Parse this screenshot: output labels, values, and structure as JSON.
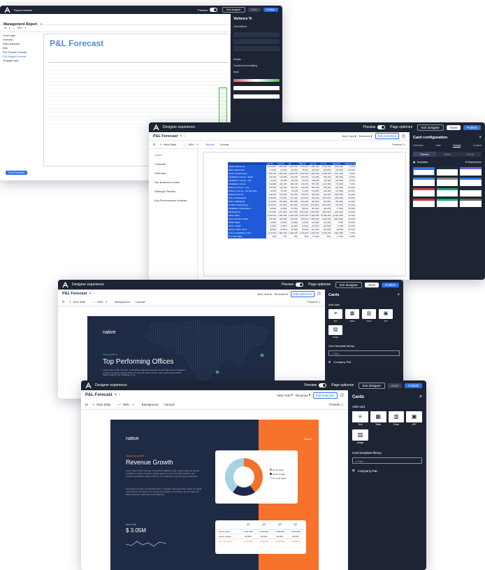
{
  "win1": {
    "app_title": "Report Header",
    "title": "Management Report",
    "page_title": "P&L Forecast",
    "nav_items": [
      "Cover page",
      "Overview",
      "Sales summary",
      "Risk",
      "P&L Product Forecast",
      "P&L Budget Forecast",
      "Template slide"
    ],
    "right_panel_title": "Variance %",
    "right_panel_sections": [
      "Calculations",
      "Details",
      "Conditional formatting",
      "Style"
    ],
    "preview_label": "Preview",
    "exit_designer": "Exit designer",
    "save": "Save",
    "publish": "Publish",
    "footer_button": "Send feedback"
  },
  "win2": {
    "app_title": "Designer experience",
    "preview_label": "Preview",
    "page_options": "Page options",
    "exit_designer": "Exit designer",
    "save": "Save",
    "publish": "Publish",
    "report_title": "P&L Forecast",
    "new_slide": "New Slide",
    "zoom": "96%",
    "tabs": [
      "Stories",
      "Format"
    ],
    "present": "Present",
    "filter_ny": "New York",
    "filter_rev": "Revenue",
    "edit_selection": "Edit selection",
    "slides": [
      "Cover",
      "Contents",
      "Overview",
      "Our Business model",
      "Strategic Review",
      "Key Performance Indicato..."
    ],
    "card_config_title": "Card configuration",
    "card_config_tabs": [
      "Overview",
      "Data",
      "Format",
      "Context"
    ],
    "card_config_subtabs": [
      "Themes",
      "Styles",
      "Format"
    ],
    "templates_label": "Templates",
    "reset_theme": "Reset theme",
    "table_headers": [
      "Jan 21",
      "Feb 21",
      "Q1",
      "Mar 21",
      "Apr 21",
      "FY 21",
      "Variance",
      "Variance %"
    ],
    "table_rows": [
      [
        "Product Revenue",
        "1,000,000",
        "1,000,000",
        "1,000,000",
        "1,000,000",
        "1,000,000",
        "6,000,000",
        "(400,000)",
        "-7.00%"
      ],
      [
        "Sales adjustment",
        "(7,000)",
        "(8,000)",
        "(8,000)",
        "(8,000)",
        "(18,000)",
        "(68,000)",
        "(42,000)",
        "-22.00%"
      ],
      [
        "Gross product sales",
        "530,000",
        "1,000,000",
        "1,000,000",
        "1,000,000",
        "1,000,000",
        "6,000,000",
        "(447,000)",
        "-9.00%"
      ],
      [
        "Installation Income - Sales",
        "140,000",
        "140,000",
        "140,000",
        "140,000",
        "140,000",
        "840,000",
        "(60,000)",
        "-8.00%"
      ],
      [
        "Installation Income - rate",
        "40,000",
        "30,000",
        "40,000",
        "40,000",
        "160,000",
        "240,000",
        "(20,000)",
        "-8.00%"
      ],
      [
        "Installation income",
        "210,000",
        "220,000",
        "400,000",
        "210,000",
        "830,000",
        "1,100,000",
        "(70,000)",
        "-7.00%"
      ],
      [
        "Delivery Income - cost",
        "130,000",
        "110,000",
        "140,000",
        "120,000",
        "500,000",
        "600,000",
        "(28,000)",
        "-23.00%"
      ],
      [
        "Delivery income - net 3rd party",
        "30,000",
        "40,000",
        "32,000",
        "(1,000)",
        "130,000",
        "200,000",
        "(47,000)",
        "-23.00%"
      ],
      [
        "Delivery income",
        "160,000",
        "150,000",
        "110,000",
        "130,000",
        "600,000",
        "800,000",
        "(118,000)",
        "20.00%"
      ],
      [
        "Store maintenance",
        "(60,000)",
        "(70,000)",
        "(70,000)",
        "(20,000)",
        "(60,000)",
        "(190,000)",
        "(100,000)",
        "30.00%"
      ],
      [
        "Store & Buildings",
        "(20,000)",
        "(30,000)",
        "(40,000)",
        "(30,000)",
        "(60,000)",
        "(60,000)",
        "(30,000)",
        "14.00%"
      ],
      [
        "Product maintenance",
        "(60,000)",
        "(40,000)",
        "(40,000)",
        "(90,000)",
        "(170,000)",
        "(209,000)",
        "(40,000)",
        "15.00%"
      ],
      [
        "Installation maintenance",
        "(8,000)",
        "(8,000)",
        "(9,000)",
        "(8,000)",
        "(32,000)",
        "(38,000)",
        "(7,000)",
        "15.00%"
      ],
      [
        "Maintenance",
        "(90,000)",
        "(110,000)",
        "(110,000)",
        "(100,000)",
        "(460,000)",
        "(590,000)",
        "(160,000)",
        "33.00%"
      ],
      [
        "Other Sales",
        "2,090,000",
        "2,000,000",
        "2,000,000",
        "2,000,000",
        "8,000,000",
        "10,000,000",
        "(2,000,000)",
        "30.00%"
      ],
      [
        "Cost of product sales",
        "400,000",
        "400,000",
        "400,000",
        "400,000",
        "1,600,000",
        "2,000,000",
        "(800,000)",
        "30.00%"
      ],
      [
        "PPAD Sales",
        "(4,000)",
        "(5,000)",
        "(4,000)",
        "(4,000)",
        "(16,000)",
        "(20,000)",
        "4,000",
        "20.00%"
      ],
      [
        "Gross margin",
        "(4,000)",
        "(4,000)",
        "(4,000)",
        "(4,000)",
        "(16,000)",
        "(20,000)",
        "4,000",
        "20.00%"
      ],
      [
        "Service Other costs",
        "(8,000)",
        "(8,000)",
        "(8,000)",
        "(8,000)",
        "(32,000)",
        "(40,000)",
        "(8,000)",
        "15.00%"
      ],
      [
        "Cost of installation costs",
        "1,110,000",
        "1,000,000",
        "1,000,000",
        "1,000,000",
        "4,000,000",
        "5,000,000",
        "(300,000)",
        "7.00%"
      ],
      [
        "% of Net Sales",
        "78%",
        "77%",
        "76%",
        "78%",
        "77.00%",
        "80%",
        "2.78%",
        "-3.46%"
      ]
    ]
  },
  "win3": {
    "app_title": "Designer experience",
    "preview_label": "Preview",
    "page_options": "Page options",
    "exit_designer": "Exit designer",
    "save": "Save",
    "publish": "Publish",
    "report_title": "P&L Forecast",
    "new_slide": "New Slide",
    "zoom": "98%",
    "background": "Background",
    "canvas": "Canvas",
    "filter_ny": "New York",
    "filter_rev": "Revenue",
    "edit_selection": "Edit selection",
    "present": "Present",
    "slide_brand": "native",
    "slide_kicker": "Recognition",
    "slide_title": "Top Performing Offices",
    "slide_body": "Lorem ipsum dolor sit amet, consectetur adipiscing elit sed do eiusmod tempor incididunt ut labore et dolore magna aliqua. Ut enim ad minim veniam, quis nostrud exercitation ullamco laboris nisi ut aliquip ex ea.",
    "cards_title": "Cards",
    "add_card": "Add card",
    "card_types": [
      "Text",
      "Table",
      "Chart",
      "KPI",
      "Image"
    ],
    "template_library": "Card template library",
    "find_placeholder": "Find...",
    "company_pnl": "Company P&L"
  },
  "win4": {
    "app_title": "Designer experience",
    "preview_label": "Preview",
    "page_options": "Page options",
    "exit_designer": "Exit designer",
    "save": "Save",
    "publish": "Publish",
    "report_title": "P&L Forecast",
    "new_slide": "New Slide",
    "zoom": "98%",
    "background": "Background",
    "canvas": "Canvas",
    "filter_ny": "New York",
    "filter_rev": "Revenue",
    "edit_selection": "Edit selection",
    "present": "Present",
    "slide_brand": "native",
    "slide_page": "Page 6",
    "slide_kicker": "Actual by quarter",
    "slide_title": "Revenue Growth",
    "slide_body_1": "Lorem ipsum dolor sit amet, consectetur adipiscing elit, sed do eiusmod tempor incididunt ut labore et dolore magna aliqua. Ut enim ad minim veniam, quis nostrud exercitation ullamco laboris nisi ut aliquip ex ea commodo consequat.",
    "slide_body_2": "Duis aute irure dolor in reprehenderit in voluptate velit esse cillum dolore eu fugiat nulla pariatur. Excepteur sint occaecat cupidatat non proident, sunt in culpa qui officia deserunt mollit anim id est laborum.",
    "kpi_city": "New York",
    "kpi_value": "$ 3.05M",
    "legend": [
      "Gross sales",
      "Gross margin",
      "% of Net Sales"
    ],
    "legend_colors": [
      "#f2722b",
      "#1d2a4d",
      "#a9d2e0"
    ],
    "donut_values": [
      40,
      20,
      40
    ],
    "mini_table_headers": [
      "Q1",
      "Q2",
      "Q3",
      "Q4"
    ],
    "mini_table_rows": [
      [
        "Gross sales",
        "1,900,000",
        "1,800,000",
        "1,800,000",
        "1,900,000"
      ],
      [
        "Gross margin",
        "80,000",
        "80,000",
        "80,000",
        "80,000"
      ],
      [
        "% of Net Sales",
        "1,597,000",
        "1,626,000",
        "1,606,000",
        "1,626,000"
      ]
    ],
    "cards_title": "Cards",
    "add_card": "Add card",
    "card_types": [
      "Text",
      "Table",
      "Chart",
      "KPI",
      "Image"
    ],
    "template_library": "Card template library",
    "find_placeholder": "Find...",
    "company_pnl": "Company P&L"
  },
  "colors": {
    "navy": "#1d2433",
    "blue": "#2f6fe8",
    "orange": "#f7722b",
    "slide_dark": "#1f2a44",
    "table_blue": "#1f5bd8"
  }
}
